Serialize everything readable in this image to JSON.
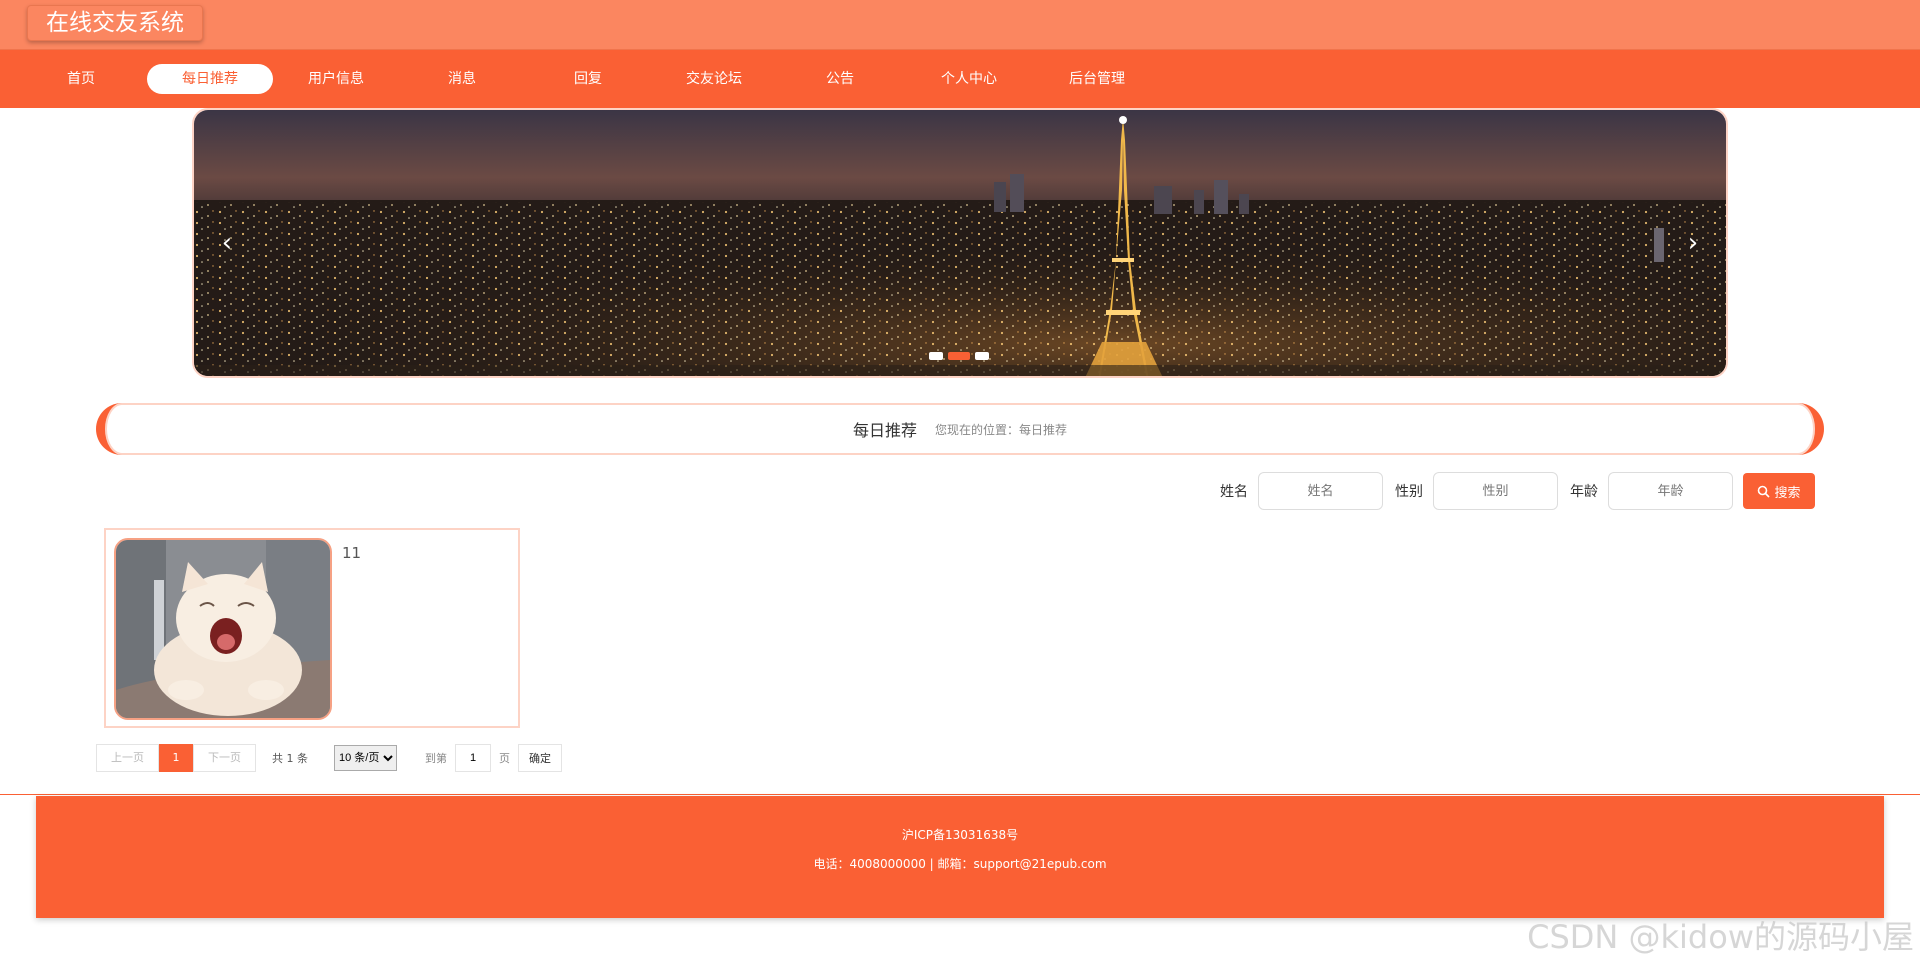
{
  "header": {
    "title": "在线交友系统"
  },
  "nav": {
    "items": [
      {
        "label": "首页"
      },
      {
        "label": "每日推荐"
      },
      {
        "label": "用户信息"
      },
      {
        "label": "消息"
      },
      {
        "label": "回复"
      },
      {
        "label": "交友论坛"
      },
      {
        "label": "公告"
      },
      {
        "label": "个人中心"
      },
      {
        "label": "后台管理"
      }
    ],
    "active_index": 1
  },
  "banner": {
    "arrow_left": "‹",
    "arrow_right": "›",
    "slide_count": 3,
    "active_slide": 1
  },
  "section": {
    "title": "每日推荐",
    "breadcrumb": "您现在的位置：每日推荐"
  },
  "search": {
    "fields": [
      {
        "label": "姓名",
        "placeholder": "姓名"
      },
      {
        "label": "性别",
        "placeholder": "性别"
      },
      {
        "label": "年龄",
        "placeholder": "年龄"
      }
    ],
    "button_label": "搜索",
    "button_icon": "search-icon"
  },
  "cards": [
    {
      "name": "11"
    }
  ],
  "pagination": {
    "prev": "上一页",
    "current": "1",
    "next": "下一页",
    "total": "共 1 条",
    "page_size": "10 条/页",
    "goto_label": "到第",
    "goto_value": "1",
    "page_unit": "页",
    "confirm": "确定"
  },
  "footer": {
    "icp": "沪ICP备13031638号",
    "contact": "电话：4008000000 | 邮箱：support@21epub.com"
  },
  "watermark": "CSDN @kidow的源码小屋",
  "colors": {
    "primary": "#fa6034",
    "header": "#fb8660",
    "border_light": "#fdd3c5"
  }
}
